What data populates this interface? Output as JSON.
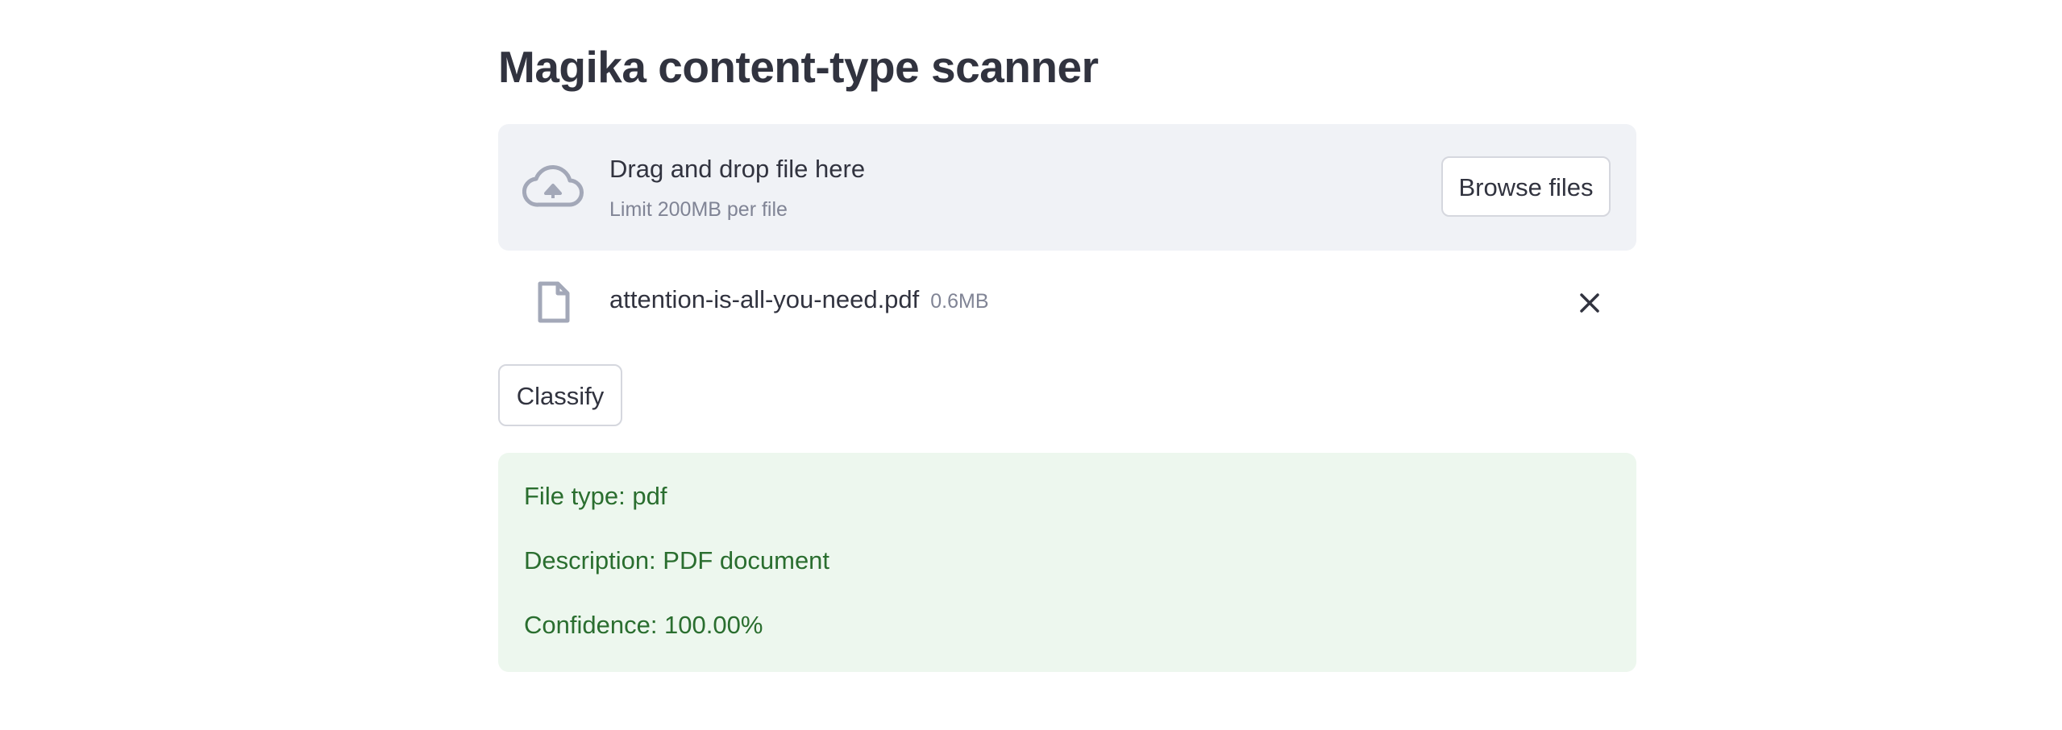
{
  "page": {
    "title": "Magika content-type scanner"
  },
  "uploader": {
    "drop_text": "Drag and drop file here",
    "limit_text": "Limit 200MB per file",
    "browse_label": "Browse files",
    "icon": "cloud-upload-icon"
  },
  "file": {
    "name": "attention-is-all-you-need.pdf",
    "size": "0.6MB",
    "icon": "file-icon",
    "remove_icon": "close-icon"
  },
  "actions": {
    "classify_label": "Classify"
  },
  "result": {
    "file_type": "File type: pdf",
    "description": "Description: PDF document",
    "confidence": "Confidence: 100.00%"
  },
  "colors": {
    "text": "#31333f",
    "muted": "#808495",
    "dropzone_bg": "#f0f2f6",
    "icon": "#a3a8b8",
    "success_bg": "#edf7ee",
    "success_text": "#2a6e2f"
  }
}
